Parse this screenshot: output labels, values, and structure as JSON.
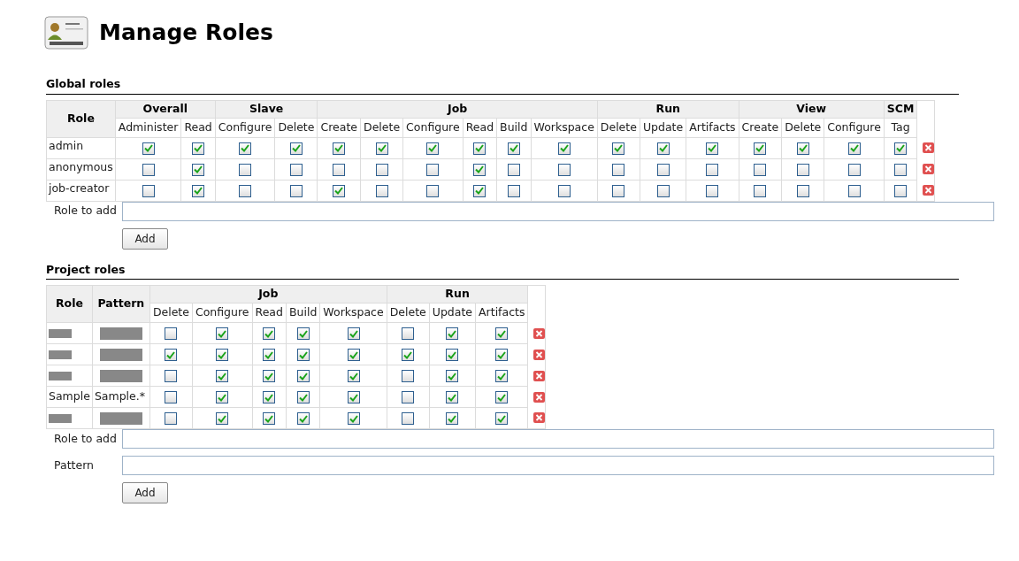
{
  "title": "Manage Roles",
  "global_roles": {
    "heading": "Global roles",
    "role_header": "Role",
    "groups": [
      {
        "label": "Overall",
        "columns": [
          "Administer",
          "Read"
        ]
      },
      {
        "label": "Slave",
        "columns": [
          "Configure",
          "Delete"
        ]
      },
      {
        "label": "Job",
        "columns": [
          "Create",
          "Delete",
          "Configure",
          "Read",
          "Build",
          "Workspace"
        ]
      },
      {
        "label": "Run",
        "columns": [
          "Delete",
          "Update",
          "Artifacts"
        ]
      },
      {
        "label": "View",
        "columns": [
          "Create",
          "Delete",
          "Configure"
        ]
      },
      {
        "label": "SCM",
        "columns": [
          "Tag"
        ]
      }
    ],
    "rows": [
      {
        "role": "admin",
        "checked": [
          true,
          true,
          true,
          true,
          true,
          true,
          true,
          true,
          true,
          true,
          true,
          true,
          true,
          true,
          true,
          true,
          true
        ]
      },
      {
        "role": "anonymous",
        "checked": [
          false,
          true,
          false,
          false,
          false,
          false,
          false,
          true,
          false,
          false,
          false,
          false,
          false,
          false,
          false,
          false,
          false
        ]
      },
      {
        "role": "job-creator",
        "checked": [
          false,
          true,
          false,
          false,
          true,
          false,
          false,
          true,
          false,
          false,
          false,
          false,
          false,
          false,
          false,
          false,
          false
        ]
      }
    ],
    "add_form": {
      "fields": [
        {
          "label": "Role to add"
        }
      ],
      "button": "Add"
    }
  },
  "project_roles": {
    "heading": "Project roles",
    "role_header": "Role",
    "pattern_header": "Pattern",
    "groups": [
      {
        "label": "Job",
        "columns": [
          "Delete",
          "Configure",
          "Read",
          "Build",
          "Workspace"
        ]
      },
      {
        "label": "Run",
        "columns": [
          "Delete",
          "Update",
          "Artifacts"
        ]
      }
    ],
    "rows": [
      {
        "role": {
          "kind": "redacted"
        },
        "pattern": {
          "kind": "redacted"
        },
        "checked": [
          false,
          true,
          true,
          true,
          true,
          false,
          true,
          true
        ]
      },
      {
        "role": {
          "kind": "redacted"
        },
        "pattern": {
          "kind": "redacted"
        },
        "checked": [
          true,
          true,
          true,
          true,
          true,
          true,
          true,
          true
        ]
      },
      {
        "role": {
          "kind": "redacted"
        },
        "pattern": {
          "kind": "redacted"
        },
        "checked": [
          false,
          true,
          true,
          true,
          true,
          false,
          true,
          true
        ]
      },
      {
        "role": {
          "kind": "text",
          "text": "Sample"
        },
        "pattern": {
          "kind": "text",
          "text": "Sample.*"
        },
        "checked": [
          false,
          true,
          true,
          true,
          true,
          false,
          true,
          true
        ]
      },
      {
        "role": {
          "kind": "redacted"
        },
        "pattern": {
          "kind": "redacted"
        },
        "checked": [
          false,
          true,
          true,
          true,
          true,
          false,
          true,
          true
        ]
      }
    ],
    "add_form": {
      "fields": [
        {
          "label": "Role to add"
        },
        {
          "label": "Pattern"
        }
      ],
      "button": "Add"
    }
  }
}
